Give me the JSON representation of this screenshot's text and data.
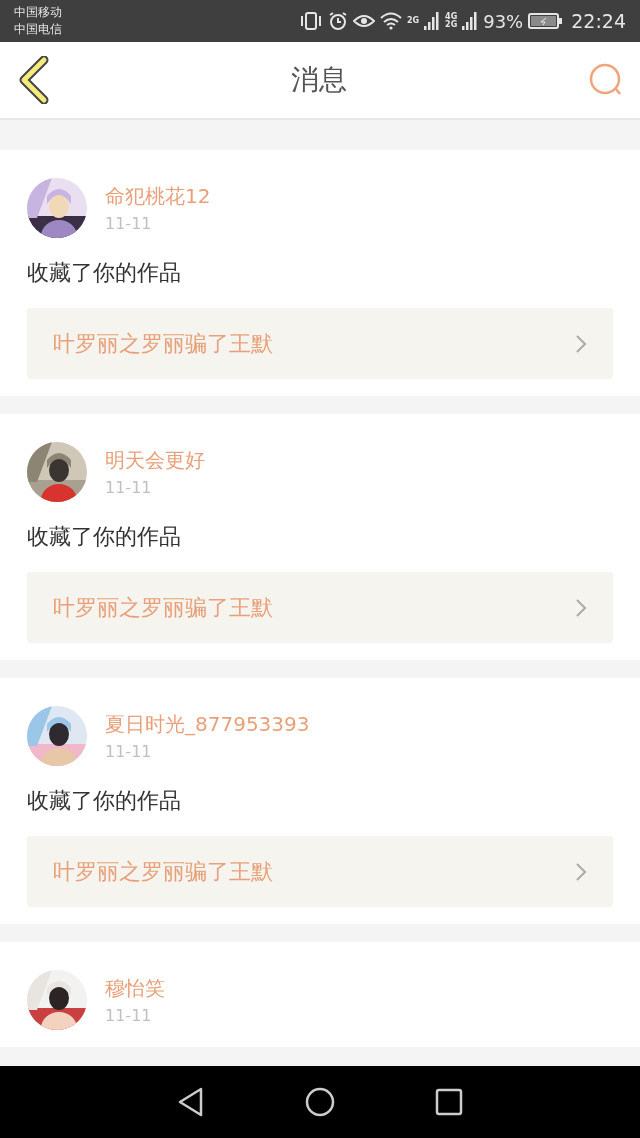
{
  "status_bar": {
    "carriers": [
      "中国移动",
      "中国电信"
    ],
    "network_1": "2G",
    "network_2_top": "4G",
    "network_2_bottom": "2G",
    "battery": "93%",
    "time": "22:24"
  },
  "header": {
    "title": "消息"
  },
  "messages": [
    {
      "user": "命犯桃花12",
      "date": "11-11",
      "action": "收藏了你的作品",
      "work": "叶罗丽之罗丽骗了王默"
    },
    {
      "user": "明天会更好",
      "date": "11-11",
      "action": "收藏了你的作品",
      "work": "叶罗丽之罗丽骗了王默"
    },
    {
      "user": "夏日时光_877953393",
      "date": "11-11",
      "action": "收藏了你的作品",
      "work": "叶罗丽之罗丽骗了王默"
    },
    {
      "user": "穆怡笑",
      "date": "11-11"
    }
  ]
}
